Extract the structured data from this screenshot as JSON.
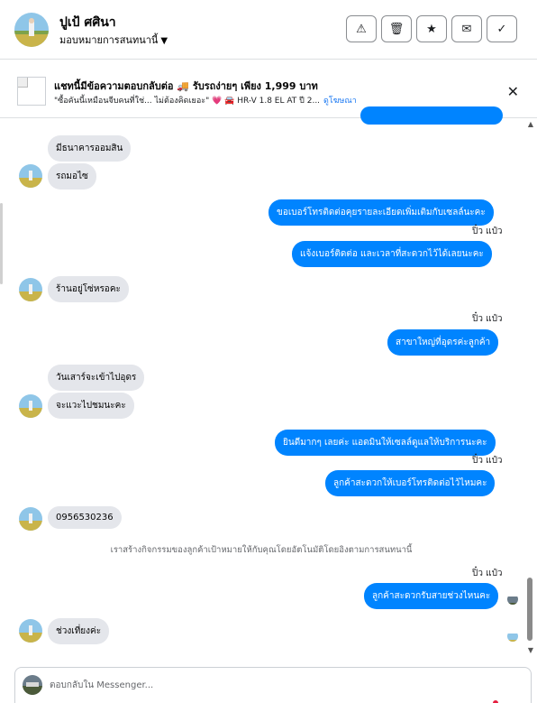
{
  "header": {
    "name": "ปูเป้ ศศินา",
    "assign_label": "มอบหมายการสนทนานี้",
    "actions": [
      {
        "icon": "warning-icon",
        "glyph": "⚠"
      },
      {
        "icon": "trash-icon",
        "glyph": "🗑"
      },
      {
        "icon": "star-icon",
        "glyph": "★"
      },
      {
        "icon": "mark-unread-icon",
        "glyph": "✉"
      },
      {
        "icon": "check-icon",
        "glyph": "✓"
      }
    ]
  },
  "ad": {
    "title": "แชทนี้มีข้อความตอบกลับต่อ 🚚 รับรถง่ายๆ เพียง 1,999 บาท",
    "subtitle": "\"ซื้อคันนี้เหมือนจีบคนที่ใช่... ไม่ต้องคิดเยอะ\" 💗 🚘 HR-V 1.8 EL AT ปี 2...",
    "link": "ดูโฆษณา"
  },
  "messages": {
    "in_bank": "มีธนาคารออมสิน",
    "in_car": "รถมอไซ",
    "out_phone_request": "ขอเบอร์โทรติดต่อคุยรายละเอียดเพิ่มเติมกับเซลล์นะคะ",
    "sender_1": "ปิ๋ว แป๋ว",
    "out_phone_time": "แจ้งเบอร์ติดต่อ  และเวลาที่สะดวกไว้ได้เลยนะคะ",
    "in_shop": "ร้านอยู่โซ่หรอคะ",
    "sender_2": "ปิ๋ว แป๋ว",
    "out_branch": "สาขาใหญ่ที่อุดรค่ะลูกค้า",
    "in_saturday": "วันเสาร์จะเข้าไปอุดร",
    "in_visit": "จะแวะไปชมนะคะ",
    "out_welcome": "ยินดีมากๆ เลยค่ะ แอดมินให้เซลล์ดูแลให้บริการนะคะ",
    "sender_3": "ปิ๋ว แป๋ว",
    "out_phone_convenient": "ลูกค้าสะดวกให้เบอร์โทรติดต่อไว้ไหมคะ",
    "in_number": "0956530236",
    "notice": "เราสร้างกิจกรรมของลูกค้าเป้าหมายให้กับคุณโดยอัตโนมัติโดยอิงตามการสนทนานี้",
    "sender_4": "ปิ๋ว แป๋ว",
    "out_call_time": "ลูกค้าสะดวกรับสายช่วงไหนคะ",
    "in_noon": "ช่วงเที่ยงค่ะ"
  },
  "composer": {
    "placeholder": "ตอบกลับใน Messenger..."
  },
  "colors": {
    "outgoing_bubble": "#0084ff",
    "incoming_bubble": "#e4e6eb",
    "link": "#1877f2"
  }
}
